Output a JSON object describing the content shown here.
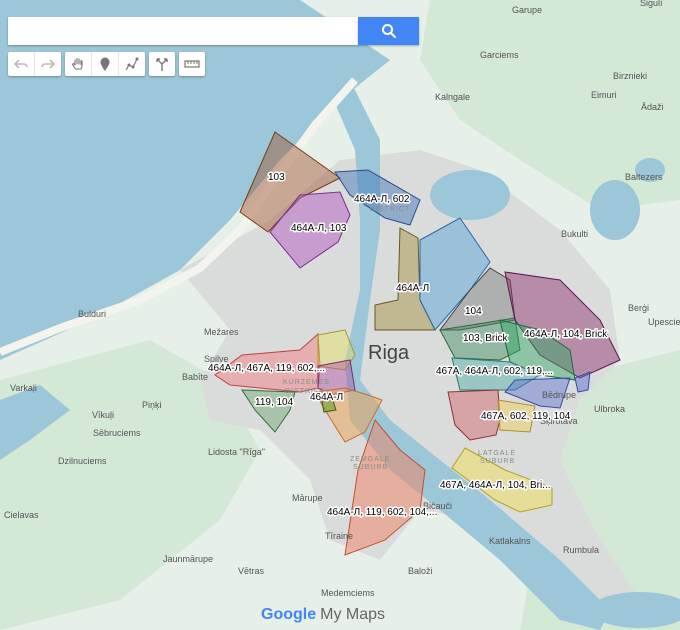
{
  "search": {
    "value": "",
    "button_icon": "search-icon"
  },
  "tools": [
    {
      "name": "undo-icon"
    },
    {
      "name": "redo-icon"
    },
    {
      "name": "hand-icon"
    },
    {
      "name": "marker-icon"
    },
    {
      "name": "draw-line-icon"
    },
    {
      "name": "directions-icon"
    },
    {
      "name": "ruler-icon"
    }
  ],
  "city": "Riga",
  "places": [
    {
      "text": "Garupe"
    },
    {
      "text": "Sigulī"
    },
    {
      "text": "Garciems"
    },
    {
      "text": "Birznieki"
    },
    {
      "text": "Kalngale"
    },
    {
      "text": "Eimuri"
    },
    {
      "text": "Ādaži"
    },
    {
      "text": "Baltezers"
    },
    {
      "text": "Bukulti"
    },
    {
      "text": "Berģi"
    },
    {
      "text": "Upesciems"
    },
    {
      "text": "Bulduri"
    },
    {
      "text": "Mežares"
    },
    {
      "text": "Spilve"
    },
    {
      "text": "Babīte"
    },
    {
      "text": "Varkaļi"
    },
    {
      "text": "Vīkuļi"
    },
    {
      "text": "Piņķi"
    },
    {
      "text": "Sēbruciems"
    },
    {
      "text": "Dzilnuciems"
    },
    {
      "text": "Lidosta \"Rīga\""
    },
    {
      "text": "Cielavas"
    },
    {
      "text": "Mārupe"
    },
    {
      "text": "Jaunmārupe"
    },
    {
      "text": "Vētras"
    },
    {
      "text": "Tīraine"
    },
    {
      "text": "Medemciems"
    },
    {
      "text": "Baloži"
    },
    {
      "text": "Katlakalns"
    },
    {
      "text": "Rumbula"
    },
    {
      "text": "Ulbroka"
    },
    {
      "text": "Bēdrupe"
    },
    {
      "text": "Bičauči"
    },
    {
      "text": "Šķirotava"
    }
  ],
  "districts": [
    {
      "text": "KURZEMES"
    },
    {
      "text": "DISTRICT"
    },
    {
      "text": "ZEMGALE"
    },
    {
      "text": "SUBURB"
    },
    {
      "text": "LATGALE"
    },
    {
      "text": "SUBURB"
    },
    {
      "text": "DISTRICT"
    }
  ],
  "regions": [
    {
      "label": "103",
      "color": "#a0522d"
    },
    {
      "label": "464А-Л, 602",
      "color": "#3b6fb6"
    },
    {
      "label": "464А-Л, 103",
      "color": "#b04fc0"
    },
    {
      "label": "464А-Л",
      "color": "#a08a3a"
    },
    {
      "label": "104",
      "color": "#777777"
    },
    {
      "label": "103, Brick",
      "color": "#3c8a5a"
    },
    {
      "label": "464А-Л, 104, Brick",
      "color": "#8b2a6a"
    },
    {
      "label": "467А, 464А-Л, 602, 119,...",
      "color": "#3aa8a0"
    },
    {
      "label": "464А-Л, 467А, 119, 602,...",
      "color": "#f28080"
    },
    {
      "label": "119, 104",
      "color": "#6aa86a"
    },
    {
      "label": "464А-Л",
      "color": "#f0a050"
    },
    {
      "label": "467А, 602, 119, 104",
      "color": "#d06060"
    },
    {
      "label": "467А, 464А-Л, 104, Bri...",
      "color": "#f0e060"
    },
    {
      "label": "464А-Л, 119, 602, 104,...",
      "color": "#f08060"
    }
  ],
  "footer": {
    "google": "Google",
    "my_maps": "My Maps"
  }
}
